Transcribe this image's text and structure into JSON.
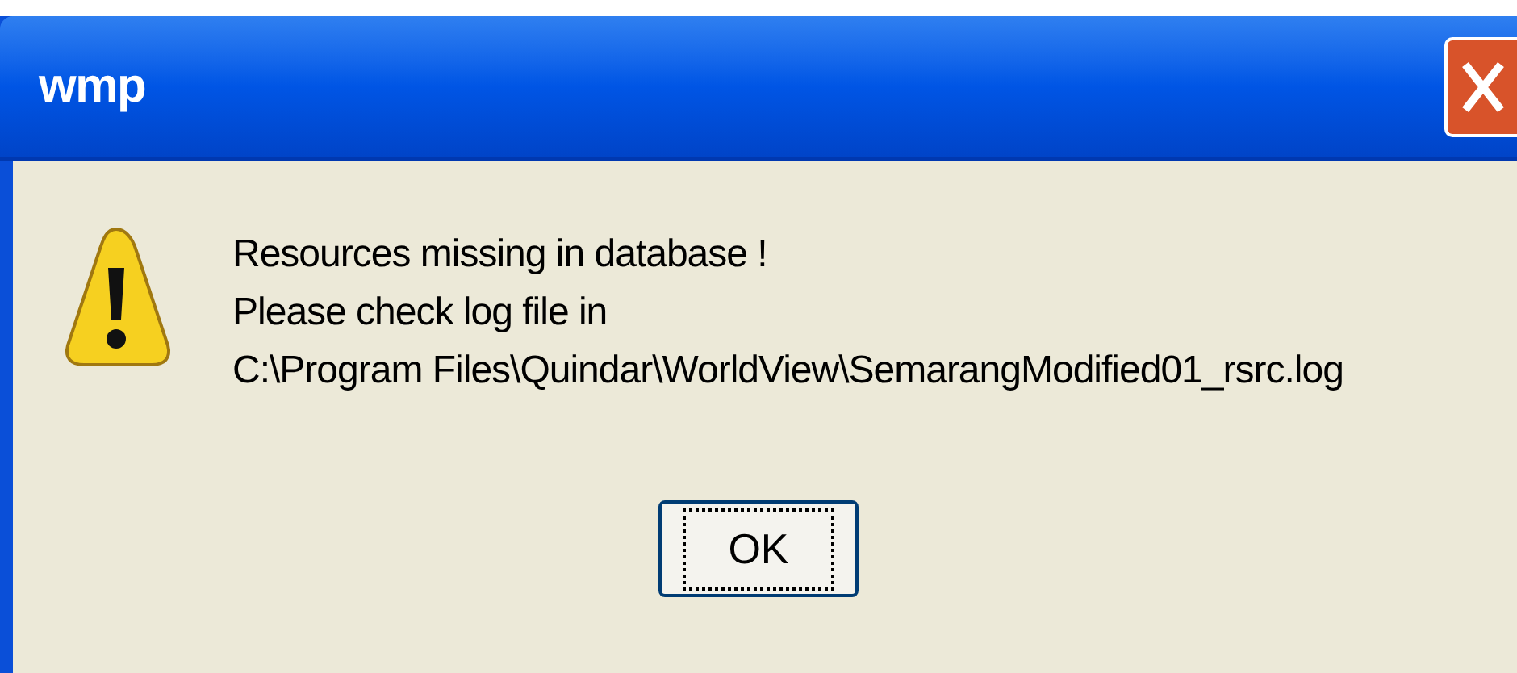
{
  "window": {
    "title": "wmp"
  },
  "message": {
    "lines": [
      "Resources missing in database !",
      "Please check log file in",
      "C:\\Program Files\\Quindar\\WorldView\\SemarangModified01_rsrc.log"
    ]
  },
  "buttons": [
    {
      "label": "OK",
      "focused": true
    }
  ]
}
